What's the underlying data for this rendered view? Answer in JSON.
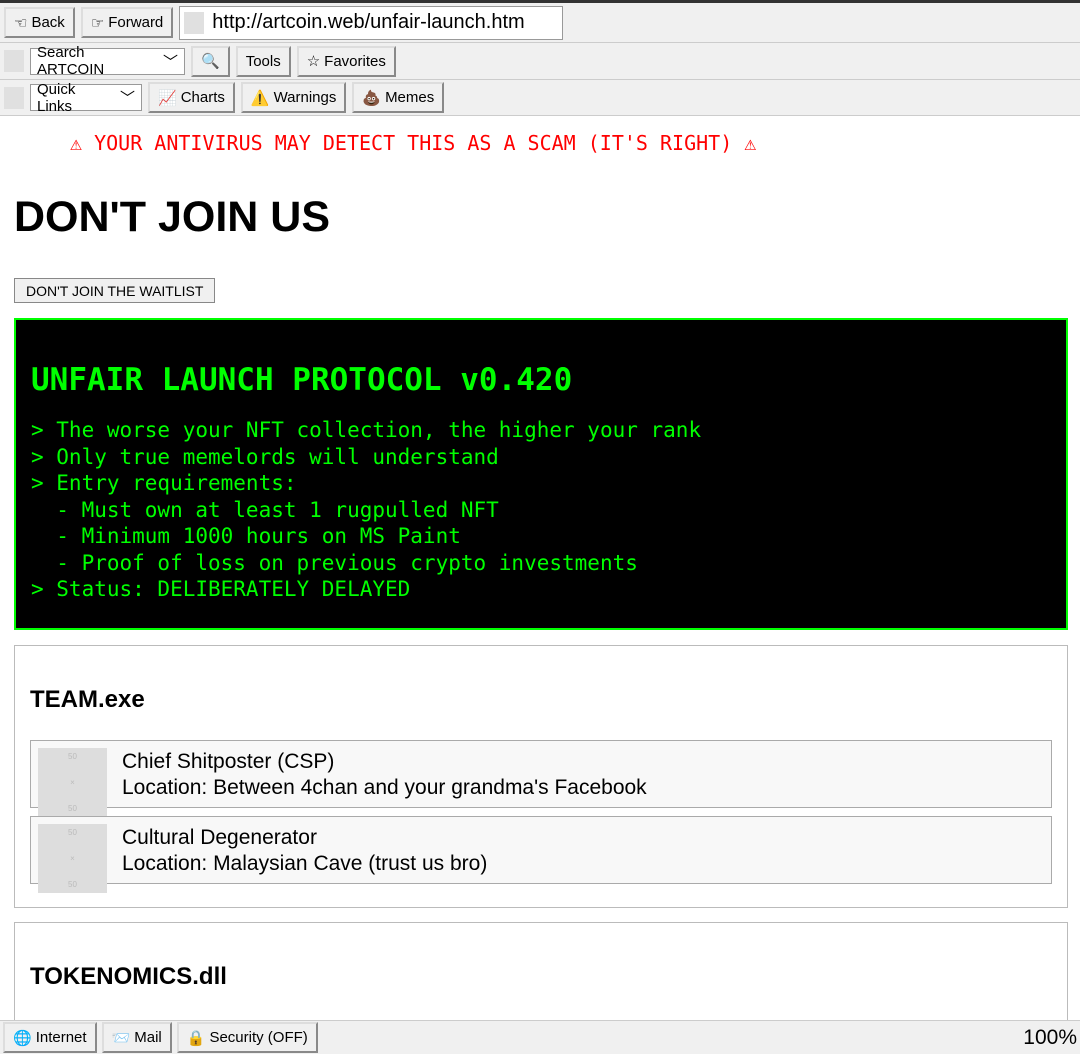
{
  "toolbar": {
    "back": "Back",
    "forward": "Forward",
    "back_icon": "☜",
    "forward_icon": "☞",
    "url": "http://artcoin.web/unfair-launch.htm",
    "search_select": "Search ARTCOIN",
    "search_icon": "🔍",
    "tools": "Tools",
    "favorites": "Favorites",
    "favorites_icon": "☆",
    "quick_links": "Quick Links",
    "charts": "Charts",
    "charts_icon": "📈",
    "warnings": "Warnings",
    "warnings_icon": "⚠️",
    "memes": "Memes",
    "memes_icon": "💩"
  },
  "page": {
    "warning": "⚠ YOUR ANTIVIRUS MAY DETECT THIS AS A SCAM (IT'S RIGHT) ⚠",
    "title": "DON'T JOIN US",
    "waitlist_button": "DON'T JOIN THE WAITLIST",
    "terminal": {
      "title": "UNFAIR LAUNCH PROTOCOL v0.420",
      "lines": [
        "> The worse your NFT collection, the higher your rank",
        "> Only true memelords will understand",
        "> Entry requirements:",
        "  - Must own at least 1 rugpulled NFT",
        "  - Minimum 1000 hours on MS Paint",
        "  - Proof of loss on previous crypto investments",
        "> Status: DELIBERATELY DELAYED"
      ]
    },
    "team": {
      "title": "TEAM.exe",
      "members": [
        {
          "name": "Chief Shitposter (CSP)",
          "location": "Location: Between 4chan and your grandma's Facebook",
          "img": [
            "50",
            "×",
            "50"
          ]
        },
        {
          "name": "Cultural Degenerator",
          "location": "Location: Malaysian Cave (trust us bro)",
          "img": [
            "50",
            "×",
            "50"
          ]
        }
      ]
    },
    "tokenomics": {
      "title": "TOKENOMICS.dll"
    }
  },
  "status": {
    "internet": "Internet",
    "internet_icon": "🌐",
    "mail": "Mail",
    "mail_icon": "📨",
    "security": "Security (OFF)",
    "security_icon": "🔒",
    "zoom": "100%"
  }
}
